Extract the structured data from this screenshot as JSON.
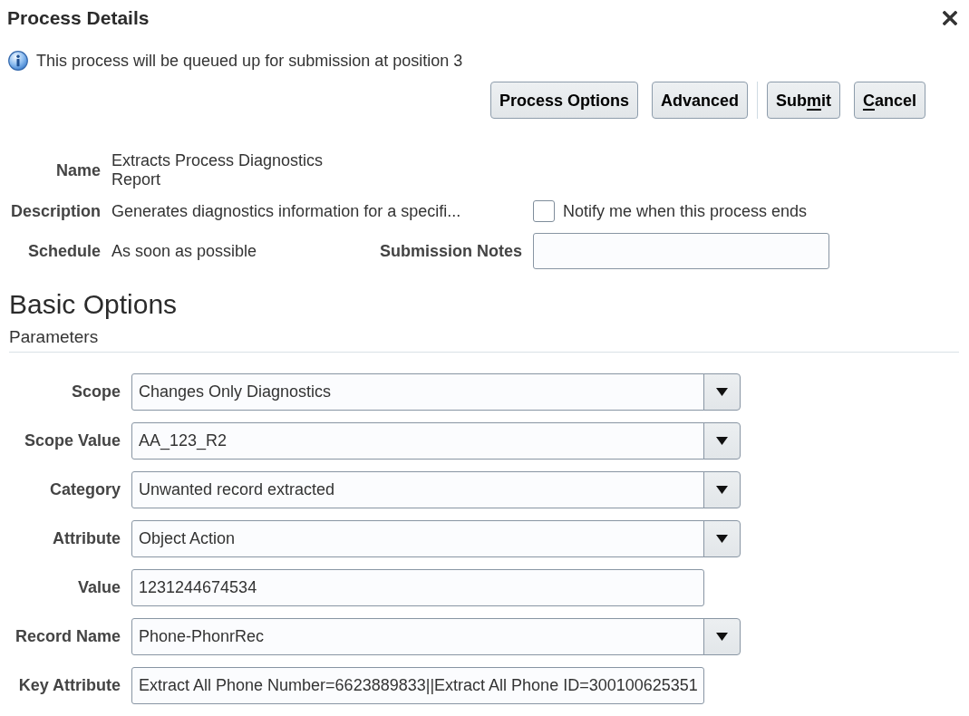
{
  "dialog": {
    "title": "Process Details"
  },
  "info_message": "This process will be queued up for submission at position 3",
  "button_groups": [
    [
      {
        "label_parts": [
          {
            "text": "Process Options",
            "underline": false
          }
        ]
      },
      {
        "label_parts": [
          {
            "text": "Advanced",
            "underline": false
          }
        ]
      }
    ],
    [
      {
        "label_parts": [
          {
            "text": "Sub",
            "underline": false
          },
          {
            "text": "m",
            "underline": true
          },
          {
            "text": "it",
            "underline": false
          }
        ]
      },
      {
        "label_parts": [
          {
            "text": "C",
            "underline": true
          },
          {
            "text": "ancel",
            "underline": false
          }
        ]
      }
    ]
  ],
  "details": [
    {
      "label": "Name",
      "value": "Extracts Process Diagnostics Report"
    },
    {
      "label": "Description",
      "value": "Generates diagnostics information for a specifi..."
    },
    {
      "label": "Schedule",
      "value": "As soon as possible"
    }
  ],
  "notify": {
    "label": "Notify me when this process ends",
    "checked": false
  },
  "submission_notes": {
    "label": "Submission Notes"
  },
  "basic_options": {
    "title": "Basic Options",
    "subtitle": "Parameters",
    "parameters": [
      {
        "label": "Scope",
        "value": "Changes Only Diagnostics",
        "kind": "select"
      },
      {
        "label": "Scope Value",
        "value": "AA_123_R2",
        "kind": "select"
      },
      {
        "label": "Category",
        "value": "Unwanted record extracted",
        "kind": "select"
      },
      {
        "label": "Attribute",
        "value": "Object Action",
        "kind": "select"
      },
      {
        "label": "Value",
        "value": "1231244674534",
        "kind": "text"
      },
      {
        "label": "Record Name",
        "value": "Phone-PhonrRec",
        "kind": "select"
      },
      {
        "label": "Key Attribute",
        "value": "Extract All Phone Number=6623889833||Extract All Phone ID=300100625351",
        "kind": "text"
      }
    ]
  }
}
